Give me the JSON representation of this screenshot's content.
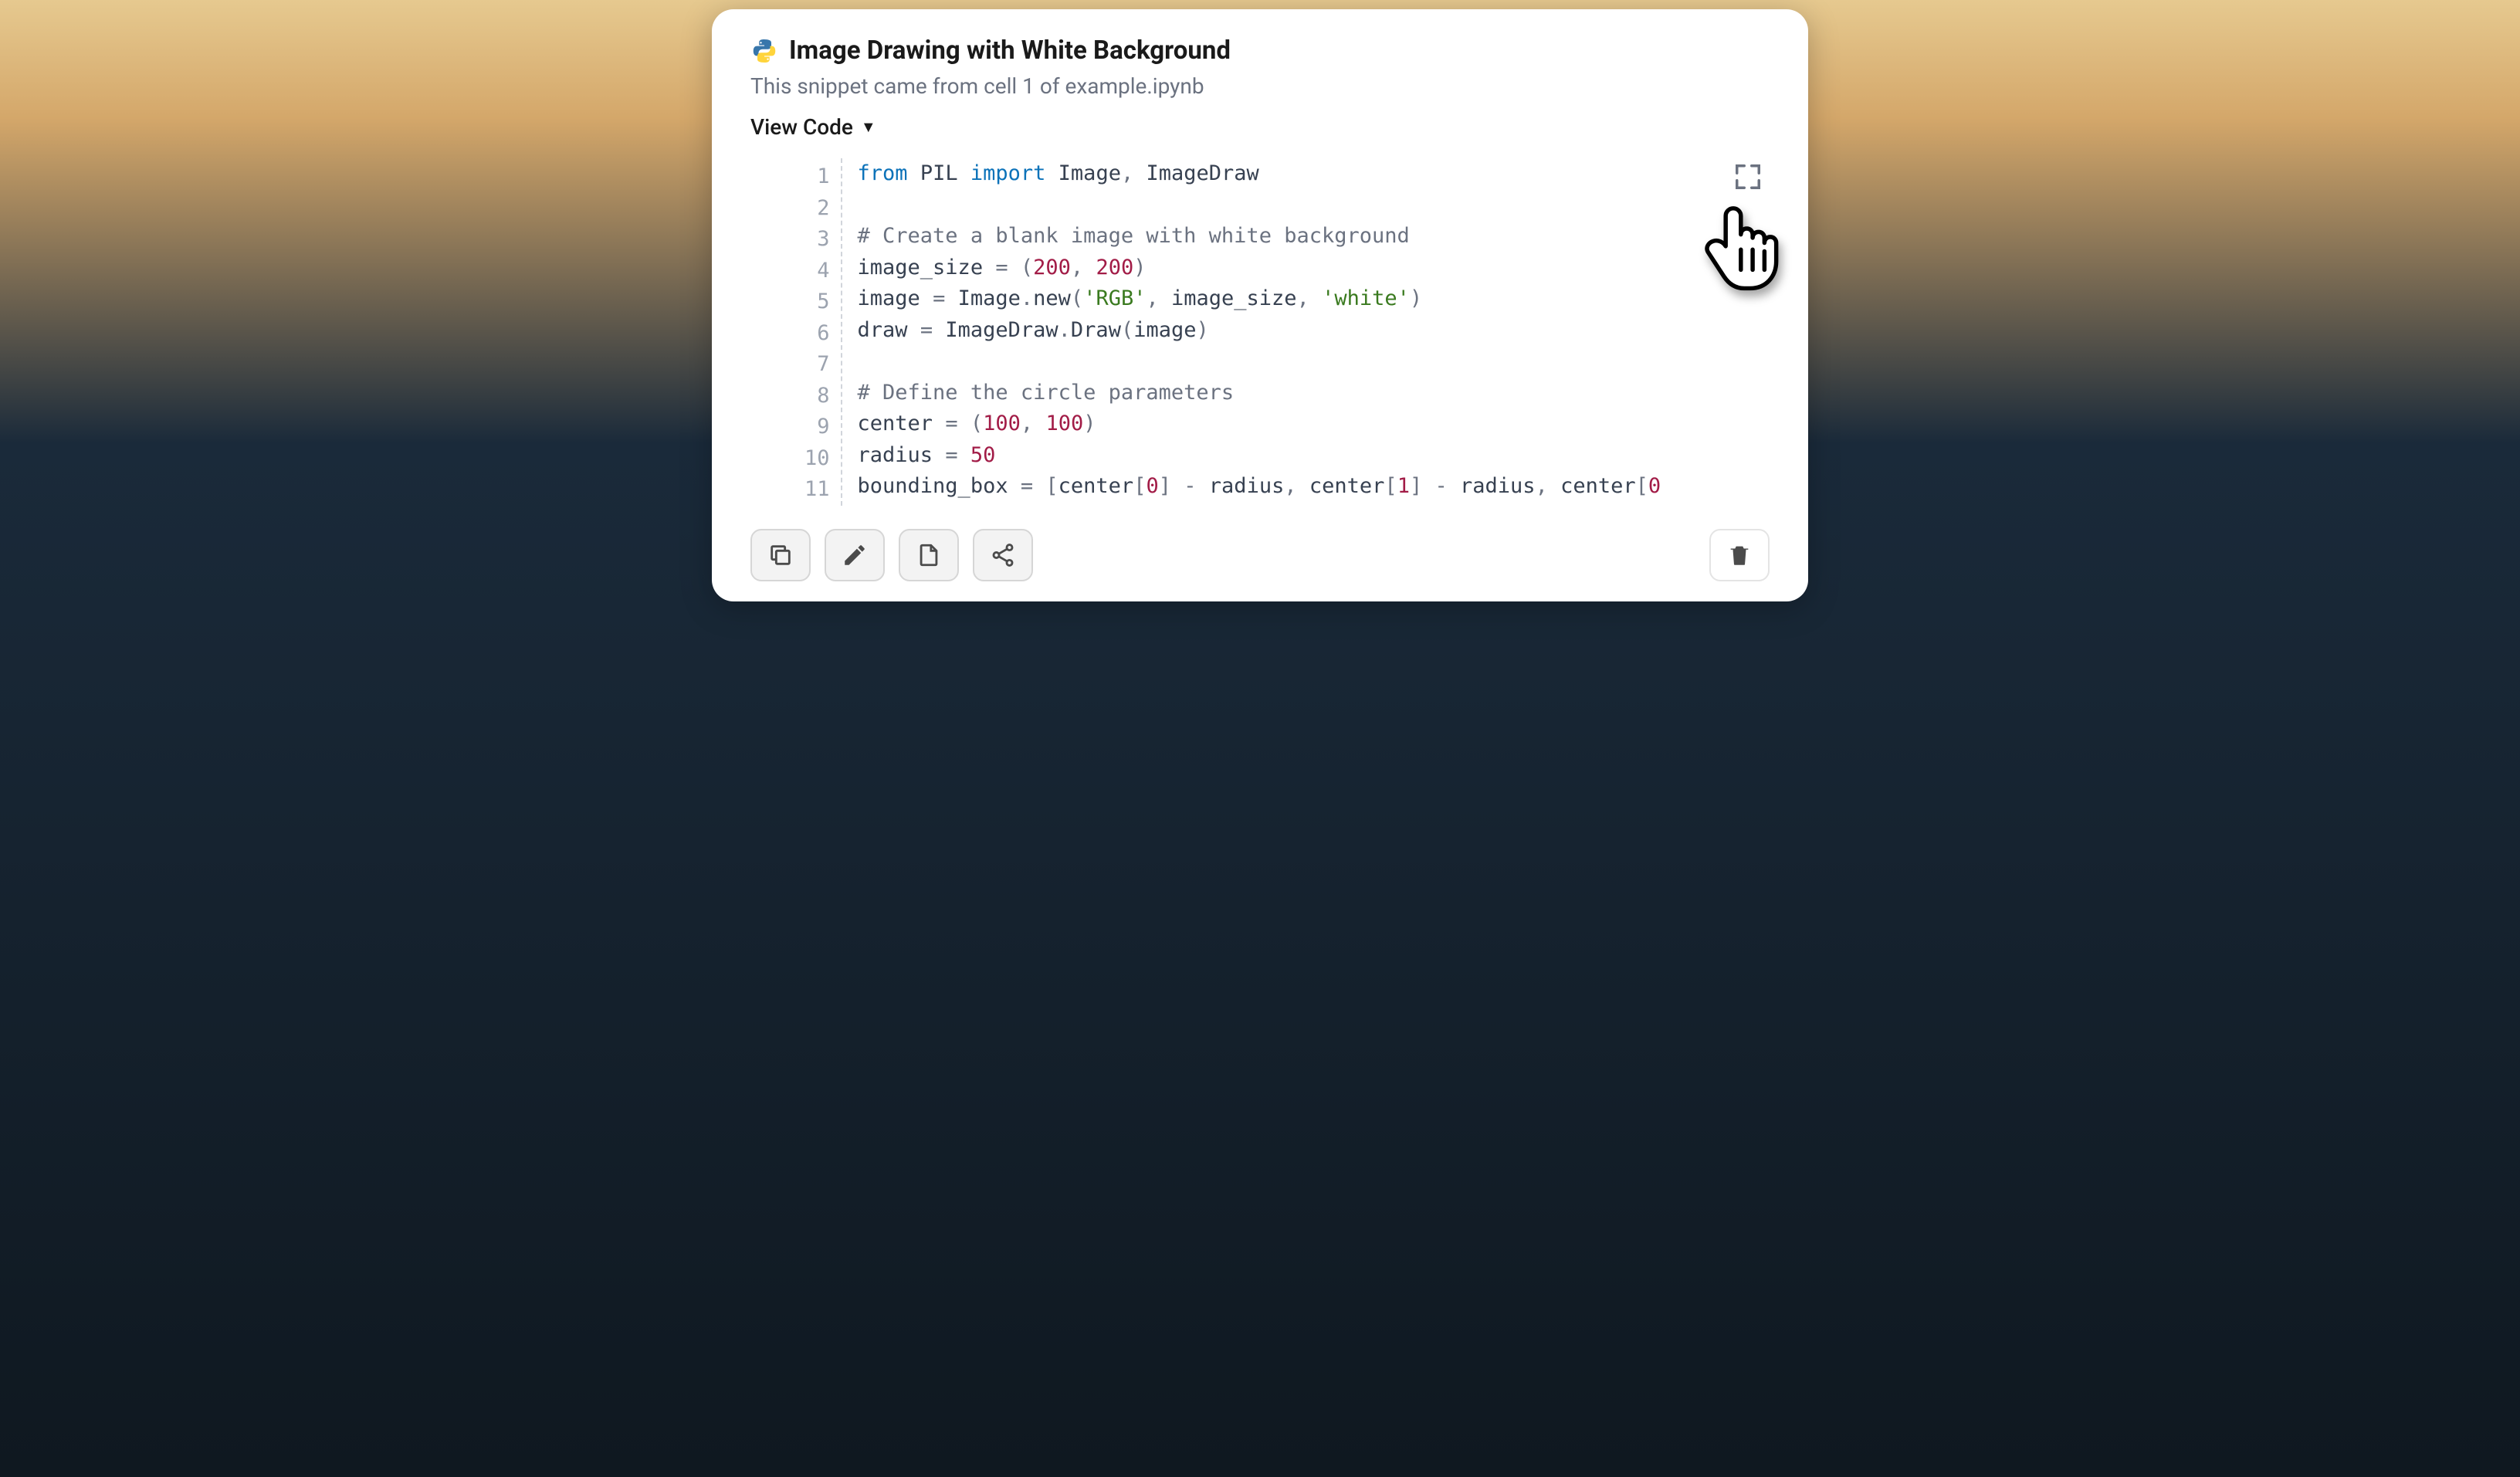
{
  "header": {
    "title": "Image Drawing with White Background",
    "subtitle": "This snippet came from cell 1 of example.ipynb",
    "viewCodeLabel": "View Code"
  },
  "code": {
    "lineNumbers": [
      "1",
      "2",
      "3",
      "4",
      "5",
      "6",
      "7",
      "8",
      "9",
      "10",
      "11"
    ],
    "tokens": [
      [
        {
          "t": "kw",
          "v": "from"
        },
        {
          "t": "sp",
          "v": " "
        },
        {
          "t": "id",
          "v": "PIL"
        },
        {
          "t": "sp",
          "v": " "
        },
        {
          "t": "kw",
          "v": "import"
        },
        {
          "t": "sp",
          "v": " "
        },
        {
          "t": "id",
          "v": "Image"
        },
        {
          "t": "op",
          "v": ","
        },
        {
          "t": "sp",
          "v": " "
        },
        {
          "t": "id",
          "v": "ImageDraw"
        }
      ],
      [],
      [
        {
          "t": "cm",
          "v": "# Create a blank image with white background"
        }
      ],
      [
        {
          "t": "id",
          "v": "image_size"
        },
        {
          "t": "sp",
          "v": " "
        },
        {
          "t": "op",
          "v": "="
        },
        {
          "t": "sp",
          "v": " "
        },
        {
          "t": "op",
          "v": "("
        },
        {
          "t": "num",
          "v": "200"
        },
        {
          "t": "op",
          "v": ","
        },
        {
          "t": "sp",
          "v": " "
        },
        {
          "t": "num",
          "v": "200"
        },
        {
          "t": "op",
          "v": ")"
        }
      ],
      [
        {
          "t": "id",
          "v": "image"
        },
        {
          "t": "sp",
          "v": " "
        },
        {
          "t": "op",
          "v": "="
        },
        {
          "t": "sp",
          "v": " "
        },
        {
          "t": "id",
          "v": "Image"
        },
        {
          "t": "op",
          "v": "."
        },
        {
          "t": "id",
          "v": "new"
        },
        {
          "t": "op",
          "v": "("
        },
        {
          "t": "str",
          "v": "'RGB'"
        },
        {
          "t": "op",
          "v": ","
        },
        {
          "t": "sp",
          "v": " "
        },
        {
          "t": "id",
          "v": "image_size"
        },
        {
          "t": "op",
          "v": ","
        },
        {
          "t": "sp",
          "v": " "
        },
        {
          "t": "str",
          "v": "'white'"
        },
        {
          "t": "op",
          "v": ")"
        }
      ],
      [
        {
          "t": "id",
          "v": "draw"
        },
        {
          "t": "sp",
          "v": " "
        },
        {
          "t": "op",
          "v": "="
        },
        {
          "t": "sp",
          "v": " "
        },
        {
          "t": "id",
          "v": "ImageDraw"
        },
        {
          "t": "op",
          "v": "."
        },
        {
          "t": "id",
          "v": "Draw"
        },
        {
          "t": "op",
          "v": "("
        },
        {
          "t": "id",
          "v": "image"
        },
        {
          "t": "op",
          "v": ")"
        }
      ],
      [],
      [
        {
          "t": "cm",
          "v": "# Define the circle parameters"
        }
      ],
      [
        {
          "t": "id",
          "v": "center"
        },
        {
          "t": "sp",
          "v": " "
        },
        {
          "t": "op",
          "v": "="
        },
        {
          "t": "sp",
          "v": " "
        },
        {
          "t": "op",
          "v": "("
        },
        {
          "t": "num",
          "v": "100"
        },
        {
          "t": "op",
          "v": ","
        },
        {
          "t": "sp",
          "v": " "
        },
        {
          "t": "num",
          "v": "100"
        },
        {
          "t": "op",
          "v": ")"
        }
      ],
      [
        {
          "t": "id",
          "v": "radius"
        },
        {
          "t": "sp",
          "v": " "
        },
        {
          "t": "op",
          "v": "="
        },
        {
          "t": "sp",
          "v": " "
        },
        {
          "t": "num",
          "v": "50"
        }
      ],
      [
        {
          "t": "id",
          "v": "bounding_box"
        },
        {
          "t": "sp",
          "v": " "
        },
        {
          "t": "op",
          "v": "="
        },
        {
          "t": "sp",
          "v": " "
        },
        {
          "t": "op",
          "v": "["
        },
        {
          "t": "id",
          "v": "center"
        },
        {
          "t": "op",
          "v": "["
        },
        {
          "t": "num",
          "v": "0"
        },
        {
          "t": "op",
          "v": "]"
        },
        {
          "t": "sp",
          "v": " "
        },
        {
          "t": "op",
          "v": "-"
        },
        {
          "t": "sp",
          "v": " "
        },
        {
          "t": "id",
          "v": "radius"
        },
        {
          "t": "op",
          "v": ","
        },
        {
          "t": "sp",
          "v": " "
        },
        {
          "t": "id",
          "v": "center"
        },
        {
          "t": "op",
          "v": "["
        },
        {
          "t": "num",
          "v": "1"
        },
        {
          "t": "op",
          "v": "]"
        },
        {
          "t": "sp",
          "v": " "
        },
        {
          "t": "op",
          "v": "-"
        },
        {
          "t": "sp",
          "v": " "
        },
        {
          "t": "id",
          "v": "radius"
        },
        {
          "t": "op",
          "v": ","
        },
        {
          "t": "sp",
          "v": " "
        },
        {
          "t": "id",
          "v": "center"
        },
        {
          "t": "op",
          "v": "["
        },
        {
          "t": "num",
          "v": "0"
        }
      ]
    ]
  },
  "icons": {
    "python": "python-icon",
    "expand": "expand-icon",
    "copy": "copy-icon",
    "edit": "pencil-icon",
    "file": "file-icon",
    "share": "share-icon",
    "trash": "trash-icon",
    "cursor": "hand-cursor-icon"
  }
}
